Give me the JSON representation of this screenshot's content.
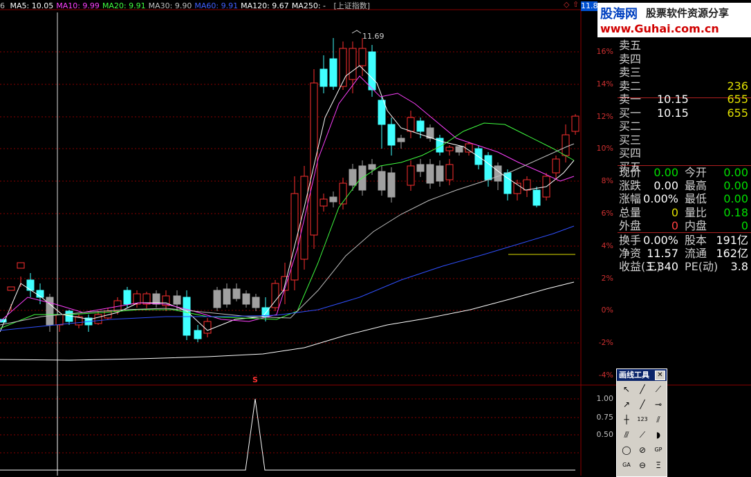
{
  "ma_bar": {
    "prefix": "6",
    "items": [
      {
        "label": "MA5: 10.05",
        "color": "#ffffff"
      },
      {
        "label": "MA10: 9.99",
        "color": "#ff40ff"
      },
      {
        "label": "MA20: 9.91",
        "color": "#40ff40"
      },
      {
        "label": "MA30: 9.90",
        "color": "#c0c0c0"
      },
      {
        "label": "MA60: 9.91",
        "color": "#4060ff"
      },
      {
        "label": "MA120: 9.67",
        "color": "#ffffff"
      },
      {
        "label": "MA250: -",
        "color": "#ffffff"
      }
    ],
    "index_label": "[上证指数]",
    "price_box": "11.8"
  },
  "logo": {
    "name": "股海网",
    "slogan": "股票软件资源分享",
    "url": "www.Guhai.com.cn"
  },
  "high_label": "11.69",
  "signal_label": "S",
  "pct_axis": [
    "16%",
    "14%",
    "12%",
    "10%",
    "8%",
    "6%",
    "4%",
    "2%",
    "0%",
    "-2%",
    "-4%"
  ],
  "indicator_axis": [
    "1.00",
    "0.75",
    "0.50"
  ],
  "order_book": [
    {
      "k": "卖五",
      "p": "",
      "v": ""
    },
    {
      "k": "卖四",
      "p": "",
      "v": ""
    },
    {
      "k": "卖三",
      "p": "",
      "v": ""
    },
    {
      "k": "卖二",
      "p": "",
      "v": "236"
    },
    {
      "k": "卖一",
      "p": "10.15",
      "v": "655"
    },
    {
      "k": "买一",
      "p": "10.15",
      "v": "655"
    },
    {
      "k": "买二",
      "p": "",
      "v": ""
    },
    {
      "k": "买三",
      "p": "",
      "v": ""
    },
    {
      "k": "买四",
      "p": "",
      "v": ""
    },
    {
      "k": "买五",
      "p": "",
      "v": ""
    }
  ],
  "quote": [
    {
      "k1": "现价",
      "v1": "0.00",
      "c1": "#00e000",
      "k2": "今开",
      "v2": "0.00",
      "c2": "#00e000"
    },
    {
      "k1": "涨跌",
      "v1": "0.00",
      "c1": "#ffffff",
      "k2": "最高",
      "v2": "0.00",
      "c2": "#00e000"
    },
    {
      "k1": "涨幅",
      "v1": "0.00%",
      "c1": "#ffffff",
      "k2": "最低",
      "v2": "0.00",
      "c2": "#00e000"
    },
    {
      "k1": "总量",
      "v1": "0",
      "c1": "#e0e000",
      "k2": "量比",
      "v2": "0.18",
      "c2": "#00e000"
    },
    {
      "k1": "外盘",
      "v1": "0",
      "c1": "#ff4040",
      "k2": "内盘",
      "v2": "0",
      "c2": "#00e000"
    }
  ],
  "finance": [
    {
      "k1": "换手",
      "v1": "0.00%",
      "k2": "股本",
      "v2": "191亿"
    },
    {
      "k1": "净资",
      "v1": "11.57",
      "k2": "流通",
      "v2": "162亿"
    },
    {
      "k1": "收益(三)",
      "v1": "1.340",
      "k2": "PE(动)",
      "v2": "3.8"
    }
  ],
  "toolbox": {
    "title": "画线工具",
    "tools": [
      {
        "name": "pointer-tool-icon",
        "glyph": "↖"
      },
      {
        "name": "line-tool-icon",
        "glyph": "╱"
      },
      {
        "name": "ray-tool-icon",
        "glyph": "⟋"
      },
      {
        "name": "arrow-tool-icon",
        "glyph": "↗"
      },
      {
        "name": "segment-tool-icon",
        "glyph": "╱"
      },
      {
        "name": "hline-tool-icon",
        "glyph": "⊸"
      },
      {
        "name": "vline-tool-icon",
        "glyph": "┼"
      },
      {
        "name": "wave-tool-icon",
        "glyph": "123"
      },
      {
        "name": "parallel-tool-icon",
        "glyph": "⫽"
      },
      {
        "name": "channel-tool-icon",
        "glyph": "⫻"
      },
      {
        "name": "fan-tool-icon",
        "glyph": "⟋"
      },
      {
        "name": "arc-tool-icon",
        "glyph": "◗"
      },
      {
        "name": "circle-tool-icon",
        "glyph": "◯"
      },
      {
        "name": "ellipse-tool-icon",
        "glyph": "⊘"
      },
      {
        "name": "gp-tool-icon",
        "glyph": "GP"
      },
      {
        "name": "ga-tool-icon",
        "glyph": "GA"
      },
      {
        "name": "cycle-tool-icon",
        "glyph": "⊖"
      },
      {
        "name": "text-tool-icon",
        "glyph": "Ξ"
      }
    ]
  },
  "colors": {
    "up": "#ff3030",
    "down": "#40ffff",
    "flat": "#a0a0a0",
    "grid": "#8b0000"
  }
}
